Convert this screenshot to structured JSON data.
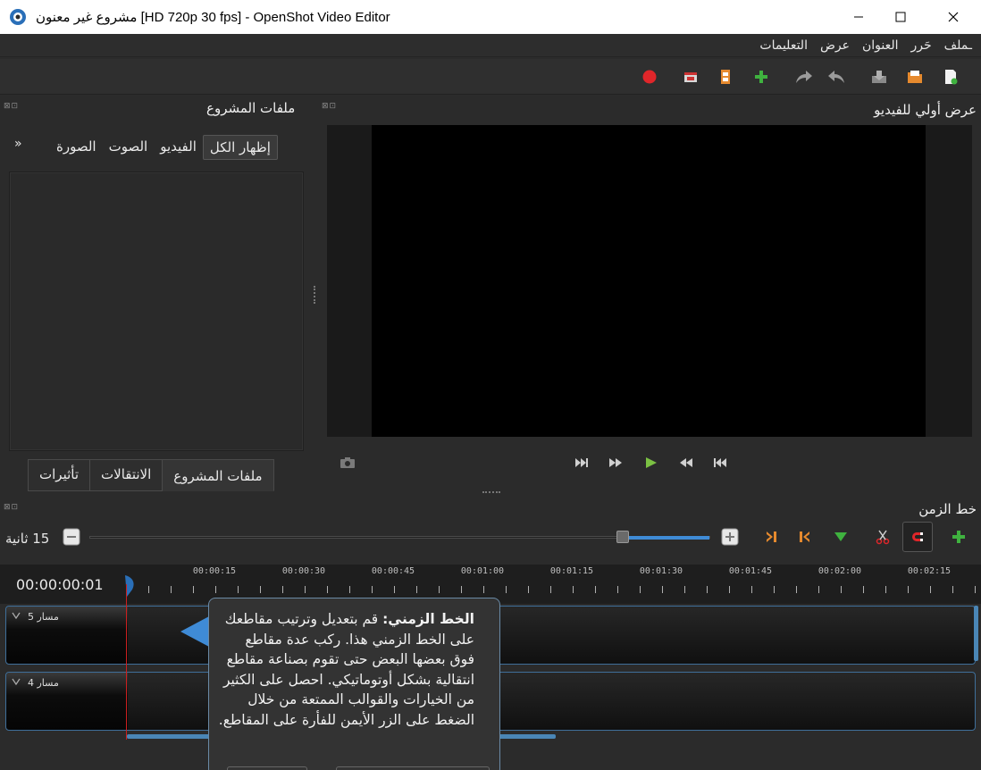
{
  "window": {
    "title": "مشروع غير معنون [HD 720p 30 fps] - OpenShot Video Editor",
    "minimize": "—",
    "maximize": "☐",
    "close": "✕"
  },
  "menu": [
    "ـملف",
    "حَرر",
    "العنوان",
    "عرض",
    "التعليمات"
  ],
  "project_files": {
    "title": "ملفات المشروع",
    "filters": [
      "إظهار الكل",
      "الفيديو",
      "الصوت",
      "الصورة"
    ],
    "more": "»"
  },
  "bottom_tabs": [
    "ملفات المشروع",
    "الانتقالات",
    "تأثيرات"
  ],
  "preview": {
    "title": "عرض أولي للفيديو"
  },
  "timeline": {
    "title": "خط الزمن",
    "zoom_label": "15 ثانية",
    "timecode": "00:00:00:01",
    "ruler": [
      "00:00:15",
      "00:00:30",
      "00:00:45",
      "00:01:00",
      "00:01:15",
      "00:01:30",
      "00:01:45",
      "00:02:00",
      "00:02:15"
    ],
    "tracks": [
      "مسار 5",
      "مسار 4"
    ]
  },
  "tooltip": {
    "heading": "الخط الزمني:",
    "body": " قم بتعديل وترتيب مقاطعك على الخط الزمني هذا. ركب عدة مقاطع فوق بعضها البعض حتى تقوم بصناعة مقاطع انتقالية بشكل أوتوماتيكي. احصل على الكثير من الخيارات والقوالب الممتعة من خلال الضغط على الزر الأيمن للفأرة على المقاطع."
  },
  "colors": {
    "accent": "#3f8bd6",
    "record": "#e0262a",
    "add": "#3fb23f",
    "playhead": "#cc1f1f"
  }
}
